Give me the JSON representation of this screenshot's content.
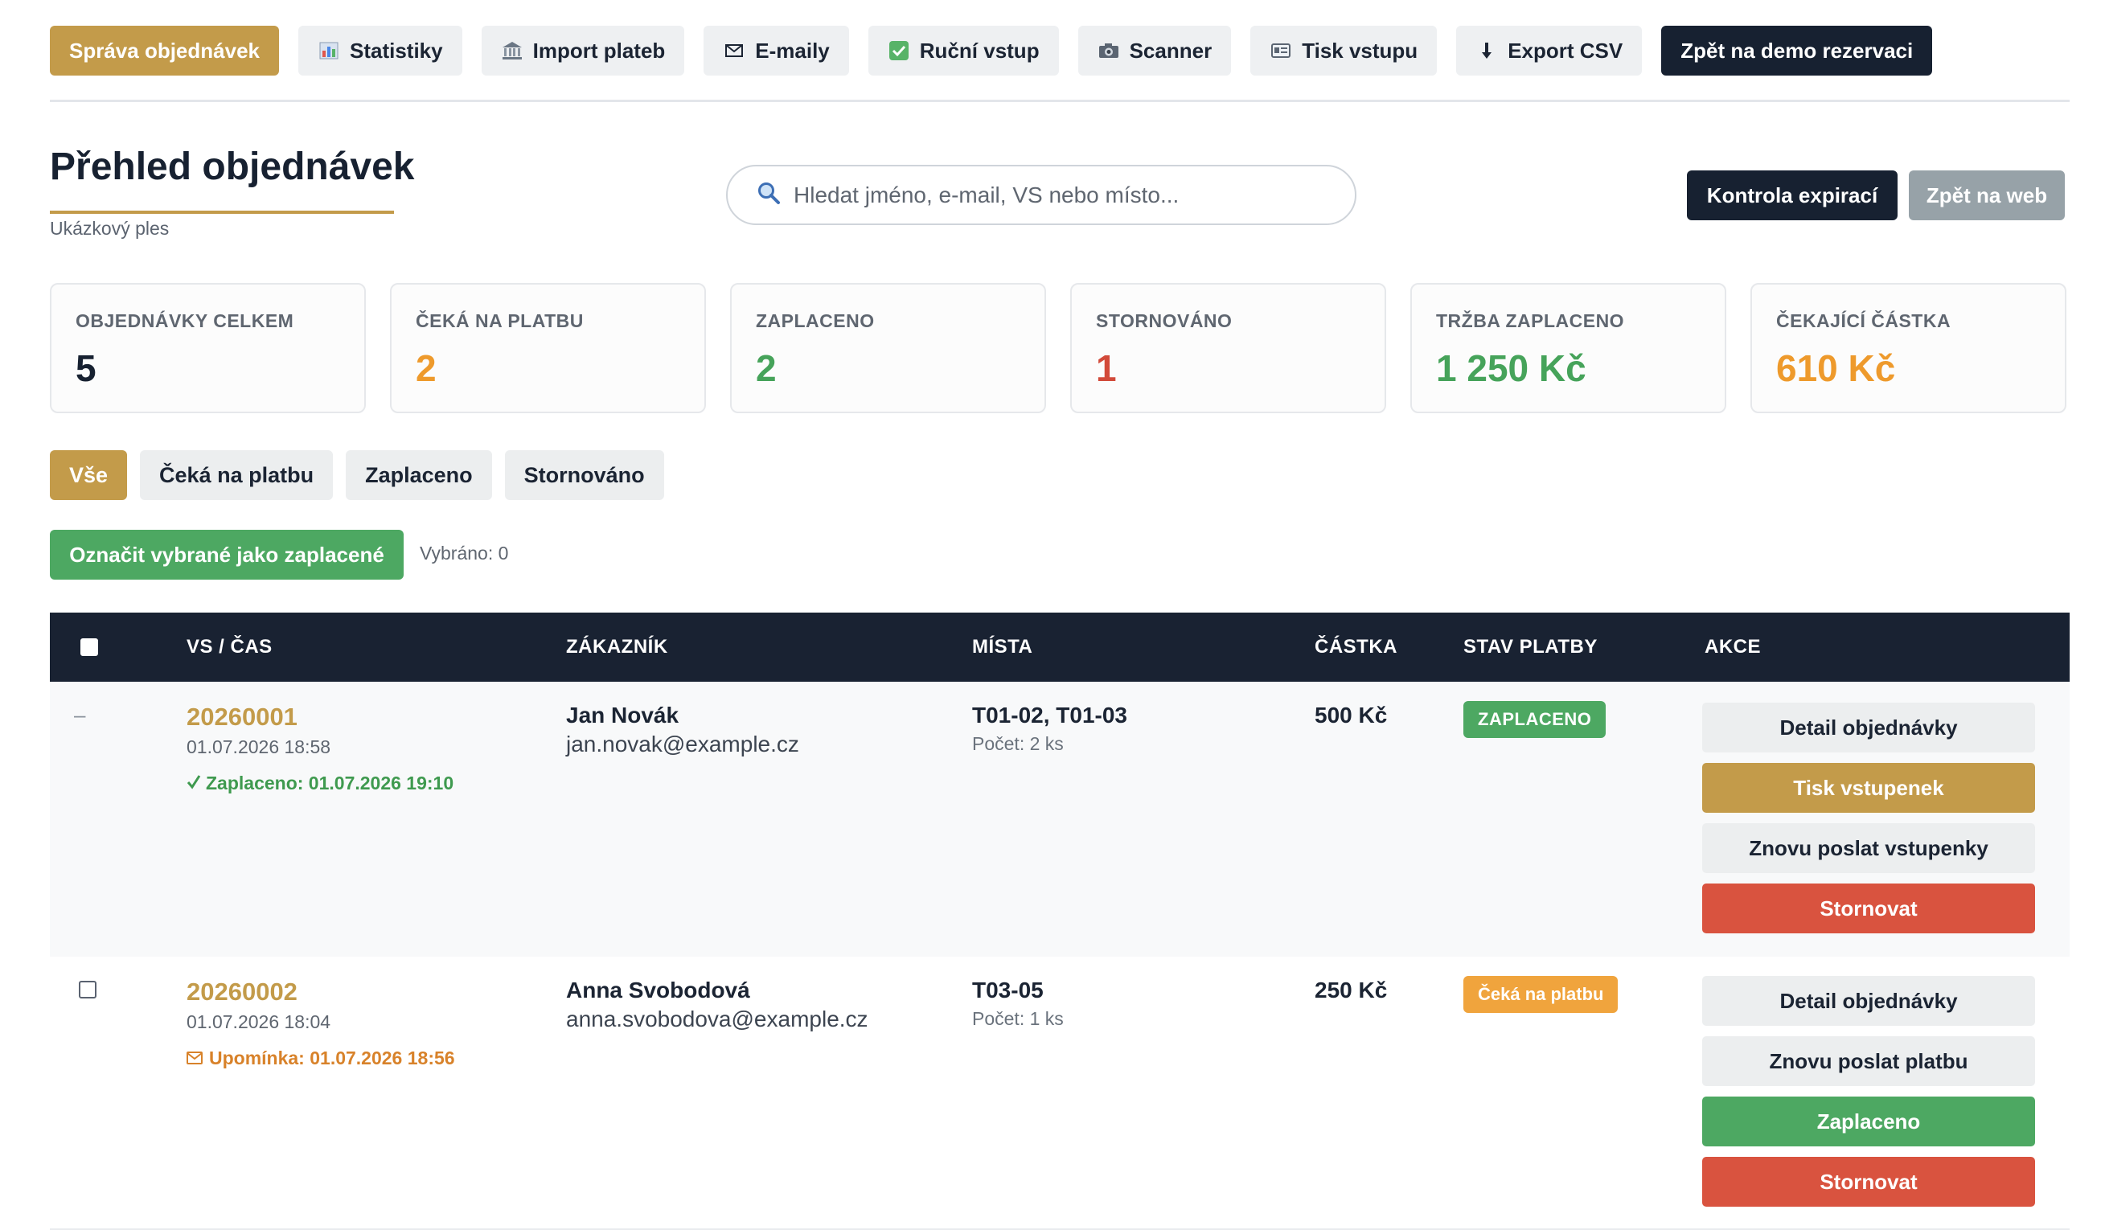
{
  "nav": {
    "items": [
      {
        "label": "Správa objednávek",
        "icon": "",
        "variant": "active"
      },
      {
        "label": "Statistiky",
        "icon": "bar-chart-icon",
        "variant": "normal"
      },
      {
        "label": "Import plateb",
        "icon": "bank-icon",
        "variant": "normal"
      },
      {
        "label": "E-maily",
        "icon": "envelope-icon",
        "variant": "normal"
      },
      {
        "label": "Ruční vstup",
        "icon": "checkmark-icon",
        "variant": "normal"
      },
      {
        "label": "Scanner",
        "icon": "camera-icon",
        "variant": "normal"
      },
      {
        "label": "Tisk vstupu",
        "icon": "id-card-icon",
        "variant": "normal"
      },
      {
        "label": "Export CSV",
        "icon": "download-arrow-icon",
        "variant": "normal"
      },
      {
        "label": "Zpět na demo rezervaci",
        "icon": "",
        "variant": "dark"
      }
    ]
  },
  "header": {
    "title": "Přehled objednávek",
    "subtitle": "Ukázkový ples",
    "search_placeholder": "Hledat jméno, e-mail, VS nebo místo...",
    "search_icon": "search-icon",
    "expiry_button": "Kontrola expirací",
    "web_button": "Zpět na web"
  },
  "stats": [
    {
      "label": "OBJEDNÁVKY CELKEM",
      "value": "5",
      "color": "#172131"
    },
    {
      "label": "ČEKÁ NA PLATBU",
      "value": "2",
      "color": "#ee9a2c"
    },
    {
      "label": "ZAPLACENO",
      "value": "2",
      "color": "#46a35a"
    },
    {
      "label": "STORNOVÁNO",
      "value": "1",
      "color": "#d24a3a"
    },
    {
      "label": "TRŽBA ZAPLACENO",
      "value": "1 250 Kč",
      "color": "#46a35a"
    },
    {
      "label": "ČEKAJÍCÍ ČÁSTKA",
      "value": "610 Kč",
      "color": "#ee9a2c"
    }
  ],
  "filters": [
    "Vše",
    "Čeká na platbu",
    "Zaplaceno",
    "Stornováno"
  ],
  "bulk": {
    "button": "Označit vybrané jako zaplacené",
    "selected": "Vybráno: 0"
  },
  "table": {
    "columns": [
      "VS / ČAS",
      "ZÁKAZNÍK",
      "MÍSTA",
      "ČÁSTKA",
      "STAV PLATBY",
      "AKCE"
    ],
    "rows": [
      {
        "vs": "20260001",
        "time": "01.07.2026 18:58",
        "note": "Zaplaceno: 01.07.2026 19:10",
        "note_icon": "checkmark-icon",
        "name": "Jan Novák",
        "email": "jan.novak@example.cz",
        "seats": "T01-02, T01-03",
        "count": "Počet: 2 ks",
        "amount": "500 Kč",
        "status": "ZAPLACENO",
        "actions": [
          "Detail objednávky",
          "Tisk vstupenek",
          "Znovu poslat vstupenky",
          "Stornovat"
        ],
        "select_marker": "–"
      },
      {
        "vs": "20260002",
        "time": "01.07.2026 18:04",
        "note": "Upomínka: 01.07.2026 18:56",
        "note_icon": "envelope-icon",
        "name": "Anna Svobodová",
        "email": "anna.svobodova@example.cz",
        "seats": "T03-05",
        "count": "Počet: 1 ks",
        "amount": "250 Kč",
        "status": "Čeká na platbu",
        "actions": [
          "Detail objednávky",
          "Znovu poslat platbu",
          "Zaplaceno",
          "Stornovat"
        ]
      }
    ]
  },
  "colors": {
    "accent": "#c39b4a",
    "dark": "#172131",
    "green": "#4da862",
    "orange": "#f0a43d",
    "red": "#d9533f"
  }
}
